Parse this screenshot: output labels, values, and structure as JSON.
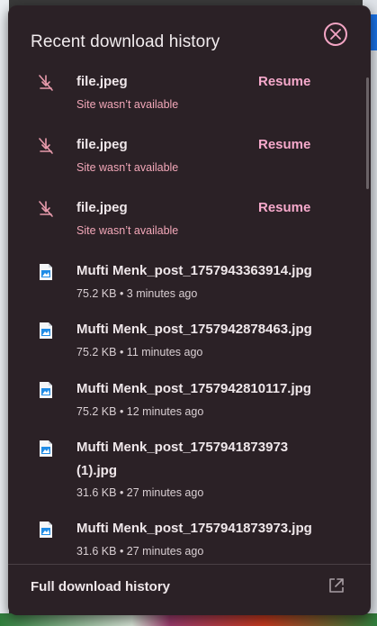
{
  "panel": {
    "title": "Recent download history",
    "footer_label": "Full download history"
  },
  "colors": {
    "panel_bg": "#2b2126",
    "accent": "#f6a9cb",
    "error_text": "#f2a7b8"
  },
  "downloads": [
    {
      "name": "file.jpeg",
      "status": "Site wasn’t available",
      "action": "Resume",
      "icon": "download-blocked-icon"
    },
    {
      "name": "file.jpeg",
      "status": "Site wasn’t available",
      "action": "Resume",
      "icon": "download-blocked-icon"
    },
    {
      "name": "file.jpeg",
      "status": "Site wasn’t available",
      "action": "Resume",
      "icon": "download-blocked-icon"
    },
    {
      "name": "Mufti Menk_post_1757943363914.jpg",
      "status": "75.2 KB • 3 minutes ago",
      "icon": "image-file-icon"
    },
    {
      "name": "Mufti Menk_post_1757942878463.jpg",
      "status": "75.2 KB • 11 minutes ago",
      "icon": "image-file-icon"
    },
    {
      "name": "Mufti Menk_post_1757942810117.jpg",
      "status": "75.2 KB • 12 minutes ago",
      "icon": "image-file-icon"
    },
    {
      "name": "Mufti Menk_post_1757941873973",
      "name_line2": "(1).jpg",
      "status": "31.6 KB • 27 minutes ago",
      "icon": "image-file-icon"
    },
    {
      "name": "Mufti Menk_post_1757941873973.jpg",
      "status": "31.6 KB • 27 minutes ago",
      "icon": "image-file-icon"
    }
  ]
}
